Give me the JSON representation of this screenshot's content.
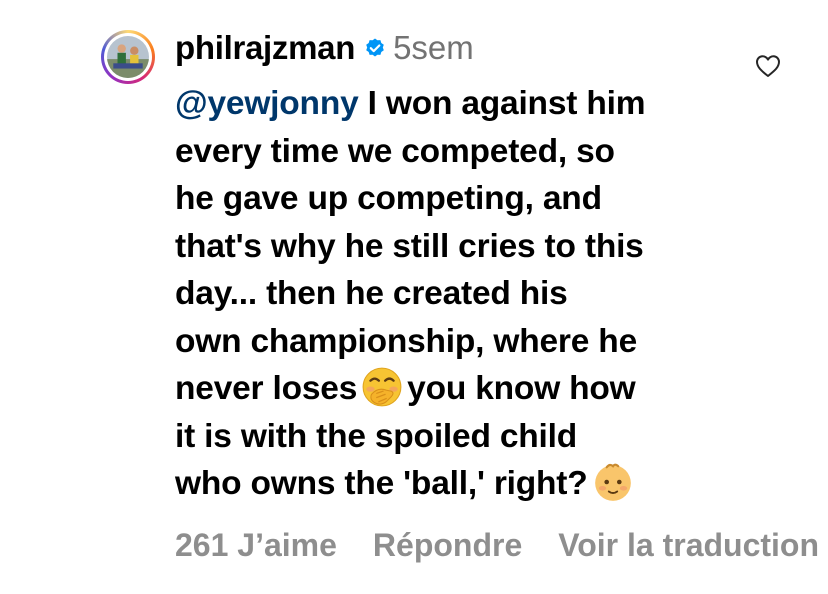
{
  "comment": {
    "username": "philrajzman",
    "timestamp": "5sem",
    "verified": true,
    "mention": "@yewjonny",
    "lines": [
      " I won against him",
      "every time we competed, so",
      "he gave up competing, and",
      "that's why he still cries to this",
      "day... then he created his",
      "own championship, where he",
      "never loses",
      "you know how",
      "it is with the spoiled child",
      "who owns the 'ball,' right?"
    ],
    "emojis": [
      "face-with-hand-over-mouth-emoji",
      "baby-emoji"
    ]
  },
  "actions": {
    "likes": "261 J’aime",
    "reply": "Répondre",
    "translate": "Voir la traduction"
  },
  "colors": {
    "mention": "#00376b",
    "verified_badge": "#0095f6",
    "muted_text": "#8e8e8e"
  },
  "icons": {
    "like": "heart-outline-icon",
    "verified": "verified-badge-icon"
  }
}
